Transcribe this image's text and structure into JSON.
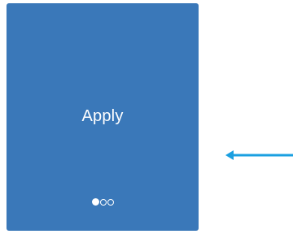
{
  "card": {
    "label": "Apply",
    "background": "#3a78b9"
  },
  "pager": {
    "pages": 3,
    "active_index": 0
  },
  "indicator_arrow": {
    "color": "#1a9fe0",
    "direction": "left"
  }
}
